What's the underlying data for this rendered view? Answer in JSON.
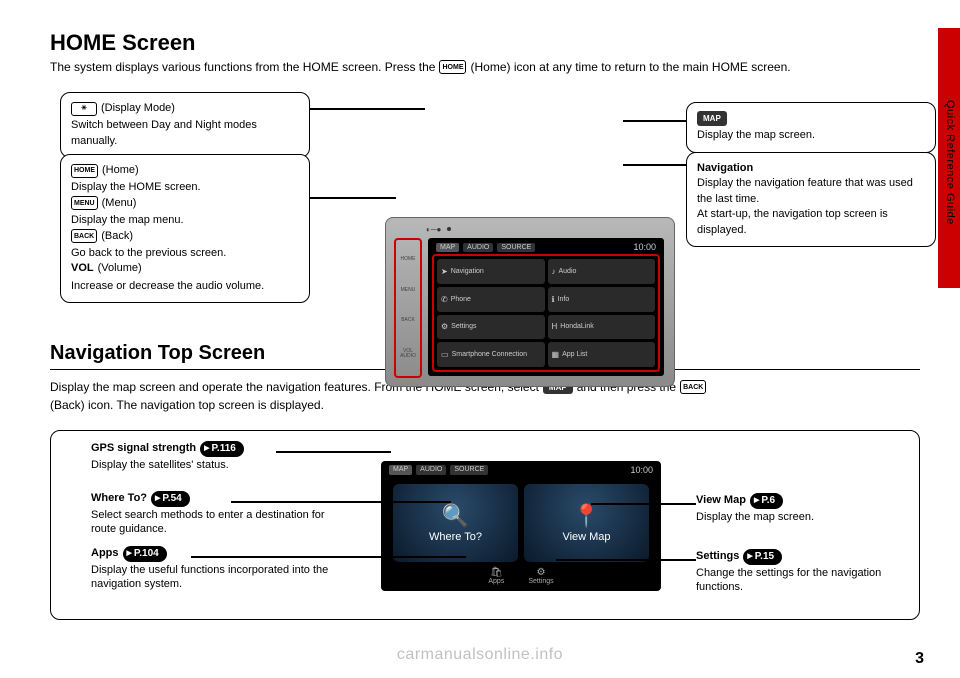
{
  "side_tab_label": "Quick Reference Guide",
  "section1": {
    "title": "HOME Screen",
    "subtitle_a": "The system displays various functions from the HOME screen. Press the",
    "subtitle_home": "HOME",
    "subtitle_b": "(Home) icon at any time to return to the main HOME screen."
  },
  "callouts": {
    "display_mode": {
      "icon": "☀",
      "label": "(Display Mode)",
      "text": "Switch between Day and Night modes manually."
    },
    "left_buttons": {
      "home_icon": "HOME",
      "home_label": "(Home)",
      "home_text": "Display the HOME screen.",
      "menu_icon": "MENU",
      "menu_label": "(Menu)",
      "menu_text": "Display the map menu.",
      "back_icon": "BACK",
      "back_label": "(Back)",
      "back_text": "Go back to the previous screen.",
      "vol_bold": "VOL",
      "vol_label": "(Volume)",
      "vol_text": "Increase or decrease the audio volume."
    },
    "map": {
      "icon": "MAP",
      "text": "Display the map screen."
    },
    "navigation": {
      "title": "Navigation",
      "text1": "Display the navigation feature that was used the last time.",
      "text2": "At start-up, the navigation top screen is displayed."
    }
  },
  "device1": {
    "clock": "10:00",
    "tabs": [
      "MAP",
      "AUDIO",
      "SOURCE"
    ],
    "side": [
      "HOME",
      "MENU",
      "BACK",
      "VOL\nAUDIO"
    ],
    "tiles": [
      {
        "icon": "➤",
        "label": "Navigation"
      },
      {
        "icon": "♪",
        "label": "Audio"
      },
      {
        "icon": "✆",
        "label": "Phone"
      },
      {
        "icon": "ℹ",
        "label": "Info"
      },
      {
        "icon": "⚙",
        "label": "Settings"
      },
      {
        "icon": "H",
        "label": "HondaLink"
      },
      {
        "icon": "▭",
        "label": "Smartphone Connection"
      },
      {
        "icon": "▦",
        "label": "App List"
      }
    ]
  },
  "section2": {
    "title": "Navigation Top Screen",
    "sub_a": "Display the map screen and operate the navigation features. From the HOME screen, select",
    "map_icon": "MAP",
    "sub_b": "and then press the",
    "back_icon": "BACK",
    "sub_c": "(Back) icon. The navigation top screen is displayed."
  },
  "labels2": {
    "gps": {
      "title": "GPS signal strength",
      "pill": "P.116",
      "text": "Display the satellites' status."
    },
    "where": {
      "title": "Where To?",
      "pill": "P.54",
      "text": "Select search methods to enter a destination for route guidance."
    },
    "apps": {
      "title": "Apps",
      "pill": "P.104",
      "text": "Display the useful functions incorporated into the navigation system."
    },
    "view": {
      "title": "View Map",
      "pill": "P.6",
      "text": "Display the map screen."
    },
    "settings": {
      "title": "Settings",
      "pill": "P.15",
      "text": "Change the settings for the navigation functions."
    }
  },
  "device2": {
    "clock": "10:00",
    "tabs": [
      "MAP",
      "AUDIO",
      "SOURCE"
    ],
    "big": [
      {
        "icon": "🔍",
        "label": "Where To?"
      },
      {
        "icon": "📍",
        "label": "View Map"
      }
    ],
    "bottom": [
      {
        "icon": "🛍",
        "label": "Apps"
      },
      {
        "icon": "⚙",
        "label": "Settings"
      }
    ]
  },
  "page_number": "3",
  "watermark": "carmanualsonline.info"
}
